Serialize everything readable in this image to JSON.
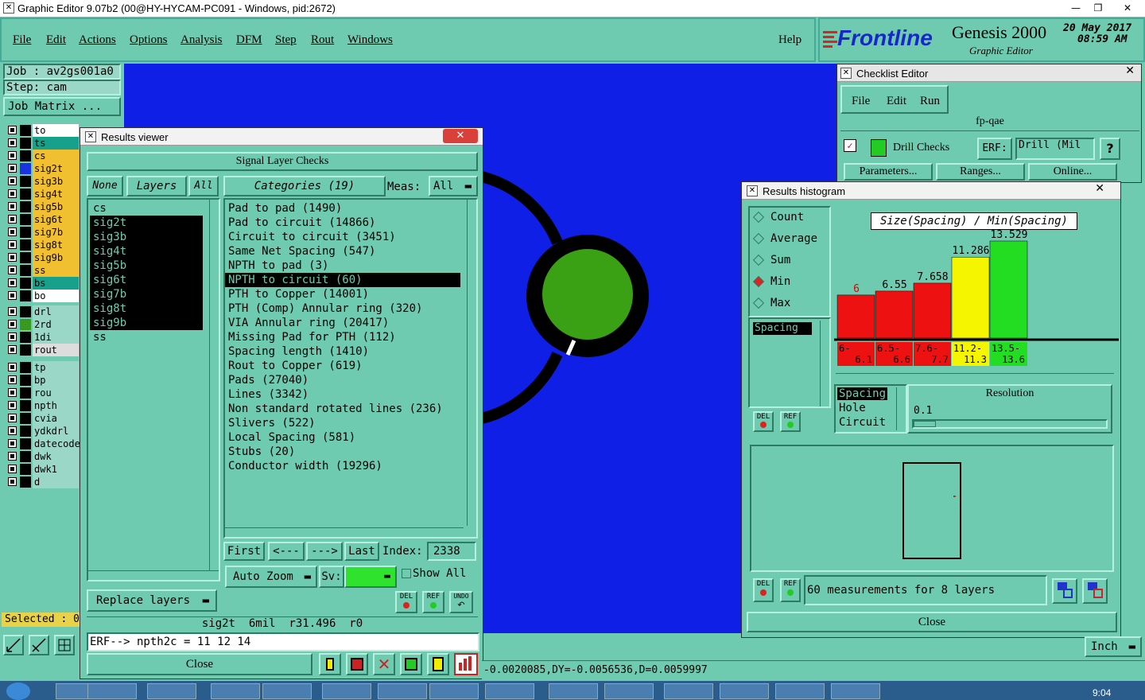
{
  "titlebar": {
    "title": "Graphic Editor 9.07b2 (00@HY-HYCAM-PC091 - Windows, pid:2672)"
  },
  "menu": {
    "items": [
      "File",
      "Edit",
      "Actions",
      "Options",
      "Analysis",
      "DFM",
      "Step",
      "Rout",
      "Windows"
    ],
    "help": "Help"
  },
  "brand": {
    "logo": "Frontline",
    "product": "Genesis 2000",
    "subtitle": "Graphic Editor",
    "date": "20 May 2017",
    "time": "08:59 AM"
  },
  "job": {
    "job_label": "Job : av2gs001a0",
    "step_label": "Step: cam",
    "matrix_button": "Job Matrix ..."
  },
  "layers": [
    {
      "name": "to",
      "color": "#ffffff",
      "swatch": "#000000"
    },
    {
      "name": "ts",
      "color": "#17a08a",
      "swatch": "#000000"
    },
    {
      "name": "cs",
      "color": "#f0c030",
      "swatch": "#000000"
    },
    {
      "name": "sig2t",
      "color": "#f0c030",
      "swatch": "#1a32e0"
    },
    {
      "name": "sig3b",
      "color": "#f0c030",
      "swatch": "#000000"
    },
    {
      "name": "sig4t",
      "color": "#f0c030",
      "swatch": "#000000"
    },
    {
      "name": "sig5b",
      "color": "#f0c030",
      "swatch": "#000000"
    },
    {
      "name": "sig6t",
      "color": "#f0c030",
      "swatch": "#000000"
    },
    {
      "name": "sig7b",
      "color": "#f0c030",
      "swatch": "#000000"
    },
    {
      "name": "sig8t",
      "color": "#f0c030",
      "swatch": "#000000"
    },
    {
      "name": "sig9b",
      "color": "#f0c030",
      "swatch": "#000000"
    },
    {
      "name": "ss",
      "color": "#f0c030",
      "swatch": "#000000"
    },
    {
      "name": "bs",
      "color": "#17a08a",
      "swatch": "#000000"
    },
    {
      "name": "bo",
      "color": "#ffffff",
      "swatch": "#000000"
    }
  ],
  "layers2": [
    {
      "name": "drl",
      "color": "#9ad7c6",
      "swatch": "#000000"
    },
    {
      "name": "2rd",
      "color": "#9ad7c6",
      "swatch": "#3a9a20"
    },
    {
      "name": "1di",
      "color": "#9ad7c6",
      "swatch": "#000000"
    },
    {
      "name": "rout",
      "color": "#dddddd",
      "swatch": "#000000"
    }
  ],
  "layers3": [
    {
      "name": "tp",
      "color": "#9ad7c6"
    },
    {
      "name": "bp",
      "color": "#9ad7c6"
    },
    {
      "name": "rou",
      "color": "#9ad7c6"
    },
    {
      "name": "npth",
      "color": "#9ad7c6"
    },
    {
      "name": "cvia",
      "color": "#9ad7c6"
    },
    {
      "name": "ydkdrl",
      "color": "#9ad7c6"
    },
    {
      "name": "datecode",
      "color": "#9ad7c6"
    },
    {
      "name": "dwk",
      "color": "#9ad7c6"
    },
    {
      "name": "dwk1",
      "color": "#9ad7c6"
    },
    {
      "name": "d",
      "color": "#9ad7c6"
    }
  ],
  "selected": "Selected : 0",
  "results_viewer": {
    "title": "Results viewer",
    "header": "Signal Layer Checks",
    "none": "None",
    "layers": "Layers",
    "all": "All",
    "categories": "Categories (19)",
    "meas_label": "Meas:",
    "meas_value": "All",
    "layer_list": [
      "cs",
      "sig2t",
      "sig3b",
      "sig4t",
      "sig5b",
      "sig6t",
      "sig7b",
      "sig8t",
      "sig9b",
      "ss"
    ],
    "selected_layers": [
      "sig2t",
      "sig3b",
      "sig4t",
      "sig5b",
      "sig6t",
      "sig7b",
      "sig8t",
      "sig9b"
    ],
    "category_list": [
      "Pad to pad (1490)",
      "Pad to circuit (14866)",
      "Circuit to circuit (3451)",
      "Same Net Spacing (547)",
      "NPTH to pad (3)",
      "NPTH to circuit (60)",
      "PTH to Copper (14001)",
      "PTH (Comp) Annular ring (320)",
      "VIA Annular ring (20417)",
      "Missing Pad for PTH (112)",
      "Spacing length (1410)",
      "Rout to Copper (619)",
      "Pads (27040)",
      "Lines (3342)",
      "Non standard rotated lines (236)",
      "Slivers (522)",
      "Local Spacing (581)",
      "Stubs (20)",
      "Conductor width (19296)"
    ],
    "selected_category": "NPTH to circuit (60)",
    "first": "First",
    "prev": "<---",
    "next": "--->",
    "last": "Last",
    "index_label": "Index:",
    "index_value": "2338",
    "auto_zoom": "Auto Zoom",
    "sv_label": "Sv:",
    "show_all": "Show All",
    "replace_layers": "Replace layers",
    "del": "DEL",
    "ref": "REF",
    "undo": "UNDO",
    "status": "sig2t  6mil  r31.496  r0",
    "erf": "ERF--> npth2c = 11 12 14",
    "close": "Close"
  },
  "checklist": {
    "title": "Checklist Editor",
    "menu": [
      "File",
      "Edit",
      "Run"
    ],
    "name": "fp-qae",
    "check": "Drill Checks",
    "erf_label": "ERF:",
    "erf_value": "Drill (Mil",
    "help": "?",
    "parameters": "Parameters...",
    "ranges": "Ranges...",
    "online": "Online..."
  },
  "histogram": {
    "title": "Results histogram",
    "modes": [
      "Count",
      "Average",
      "Sum",
      "Min",
      "Max"
    ],
    "selected_mode": "Min",
    "spacing_label": "Spacing",
    "chart_title": "Size(Spacing) / Min(Spacing)",
    "attrs": [
      "Spacing",
      "Hole",
      "Circuit"
    ],
    "resolution_label": "Resolution",
    "resolution_value": "0.1",
    "measurements": "60 measurements for 8 layers",
    "close": "Close",
    "del": "DEL",
    "ref": "REF"
  },
  "chart_data": {
    "type": "bar",
    "title": "Size(Spacing) / Min(Spacing)",
    "categories": [
      "6-\n6.1",
      "6.5-\n6.6",
      "7.6-\n7.7",
      "11.2-\n11.3",
      "13.5-\n13.6"
    ],
    "category_labels": [
      [
        "6-",
        "6.1"
      ],
      [
        "6.5-",
        "6.6"
      ],
      [
        "7.6-",
        "7.7"
      ],
      [
        "11.2-",
        "11.3"
      ],
      [
        "13.5-",
        "13.6"
      ]
    ],
    "values": [
      6,
      6.55,
      7.658,
      11.286,
      13.529
    ],
    "value_labels": [
      "6",
      "6.55",
      "7.658",
      "11.286",
      "13.529"
    ],
    "colors": [
      "#ee1111",
      "#ee1111",
      "#ee1111",
      "#f5f500",
      "#22dd22"
    ],
    "ylim": [
      0,
      13.529
    ]
  },
  "units": "Inch",
  "coords": "-0.0020085,DY=-0.0056536,D=0.0059997",
  "taskbar": {
    "time": "9:04"
  }
}
